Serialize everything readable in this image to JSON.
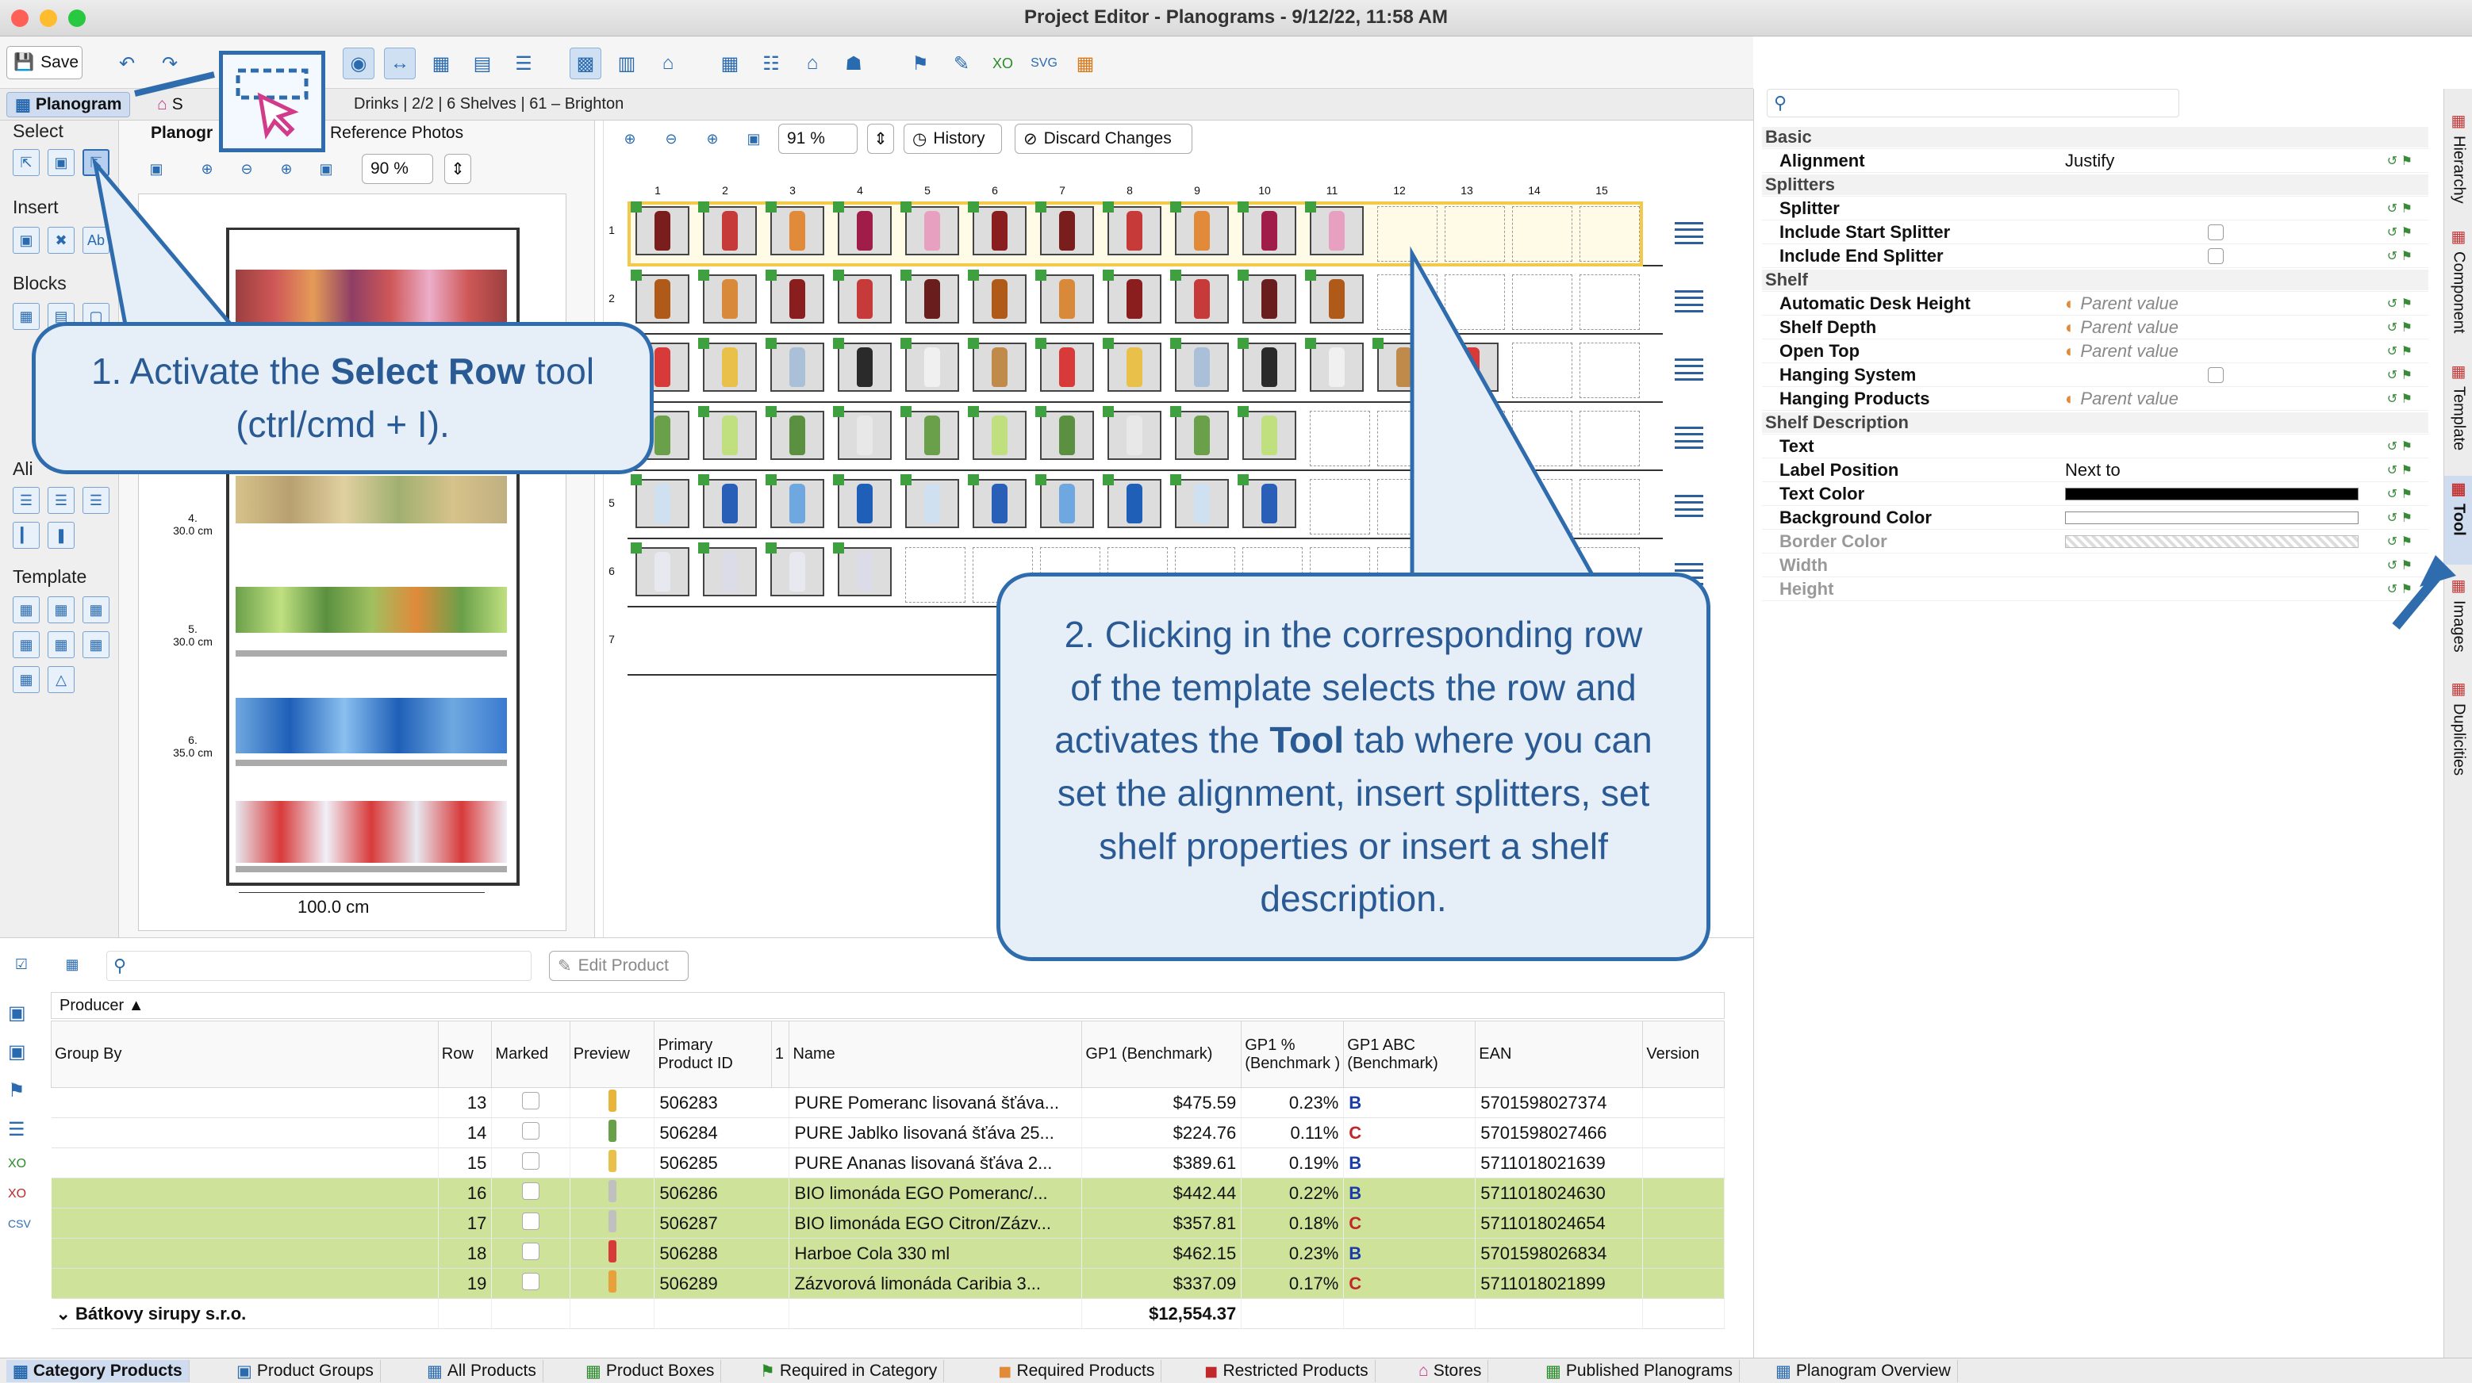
{
  "window": {
    "title": "Project Editor - Planograms - 9/12/22, 11:58 AM"
  },
  "toolbar": {
    "save_label": "Save"
  },
  "tabs": {
    "planogram": "Planogram",
    "s": "S",
    "reference_photos": "Reference Photos",
    "planogram_short": "Planogr",
    "breadcrumb": "Drinks | 2/2 | 6 Shelves | 61 – Brighton"
  },
  "left": {
    "select": "Select",
    "insert": "Insert",
    "blocks": "Blocks",
    "align": "Ali",
    "template": "Template"
  },
  "preview": {
    "zoom": "90 %",
    "width_label": "100.0 cm",
    "shelves": [
      {
        "n": "4.",
        "h": "30.0 cm"
      },
      {
        "n": "5.",
        "h": "30.0 cm"
      },
      {
        "n": "6.",
        "h": "35.0 cm"
      }
    ]
  },
  "canvas": {
    "zoom": "91 %",
    "history": "History",
    "discard": "Discard Changes",
    "cols": [
      "1",
      "2",
      "3",
      "4",
      "5",
      "6",
      "7",
      "8",
      "9",
      "10",
      "11",
      "12",
      "13",
      "14",
      "15"
    ],
    "rows": [
      "1",
      "2",
      "3",
      "4",
      "5",
      "6",
      "7"
    ]
  },
  "props": {
    "search_placeholder": "",
    "rows": [
      {
        "cat": "Basic"
      },
      {
        "k": "Alignment",
        "v": "Justify"
      },
      {
        "cat": "Splitters"
      },
      {
        "k": "Splitter",
        "v": ""
      },
      {
        "k": "Include Start Splitter",
        "v": ""
      },
      {
        "k": "Include End Splitter",
        "v": ""
      },
      {
        "cat": "Shelf"
      },
      {
        "k": "Automatic Desk Height",
        "v": "Parent value"
      },
      {
        "k": "Shelf Depth",
        "v": "Parent value"
      },
      {
        "k": "Open Top",
        "v": "Parent value"
      },
      {
        "k": "Hanging System",
        "v": ""
      },
      {
        "k": "Hanging Products",
        "v": "Parent value"
      },
      {
        "cat": "Shelf Description"
      },
      {
        "k": "Text",
        "v": ""
      },
      {
        "k": "Label Position",
        "v": "Next to"
      },
      {
        "k": "Text Color",
        "v": ""
      },
      {
        "k": "Background Color",
        "v": ""
      },
      {
        "k": "Border Color",
        "v": ""
      },
      {
        "k": "Width",
        "v": ""
      },
      {
        "k": "Height",
        "v": ""
      }
    ]
  },
  "sidetabs": [
    "Hierarchy",
    "Component",
    "Template",
    "Tool",
    "Images",
    "Duplicities"
  ],
  "bottom": {
    "edit_product": "Edit Product",
    "group_header": "Producer",
    "columns": [
      "Group By",
      "Row",
      "Marked",
      "Preview",
      "Primary Product ID",
      "1",
      "Name",
      "GP1 (Benchmark)",
      "GP1 % (Benchmark )",
      "GP1 ABC (Benchmark)",
      "EAN",
      "Version"
    ],
    "rows": [
      {
        "row": "13",
        "id": "506283",
        "name": "PURE Pomeranc lisovaná šťáva...",
        "gp1": "$475.59",
        "pct": "0.23%",
        "abc": "B",
        "ean": "5701598027374",
        "hl": false
      },
      {
        "row": "14",
        "id": "506284",
        "name": "PURE Jablko lisovaná šťáva 25...",
        "gp1": "$224.76",
        "pct": "0.11%",
        "abc": "C",
        "ean": "5701598027466",
        "hl": false
      },
      {
        "row": "15",
        "id": "506285",
        "name": "PURE Ananas lisovaná šťáva 2...",
        "gp1": "$389.61",
        "pct": "0.19%",
        "abc": "B",
        "ean": "5711018021639",
        "hl": false
      },
      {
        "row": "16",
        "id": "506286",
        "name": "BIO limonáda EGO Pomeranc/...",
        "gp1": "$442.44",
        "pct": "0.22%",
        "abc": "B",
        "ean": "5711018024630",
        "hl": true
      },
      {
        "row": "17",
        "id": "506287",
        "name": "BIO limonáda EGO Citron/Zázv...",
        "gp1": "$357.81",
        "pct": "0.18%",
        "abc": "C",
        "ean": "5711018024654",
        "hl": true
      },
      {
        "row": "18",
        "id": "506288",
        "name": "Harboe Cola 330 ml",
        "gp1": "$462.15",
        "pct": "0.23%",
        "abc": "B",
        "ean": "5701598026834",
        "hl": true
      },
      {
        "row": "19",
        "id": "506289",
        "name": "Zázvorová limonáda Caribia 3...",
        "gp1": "$337.09",
        "pct": "0.17%",
        "abc": "C",
        "ean": "5711018021899",
        "hl": true
      }
    ],
    "group_footer": {
      "name": "Bátkovy sirupy s.r.o.",
      "total": "$12,554.37"
    }
  },
  "status_tabs": [
    "Category Products",
    "Product Groups",
    "All Products",
    "Product Boxes",
    "Required in Category",
    "Required Products",
    "Restricted Products",
    "Stores",
    "Published Planograms",
    "Planogram Overview"
  ],
  "callouts": {
    "c1_a": "1. Activate the ",
    "c1_b": "Select Row",
    "c1_c": " tool (ctrl/cmd + I).",
    "c2_a": "2. Clicking in the corresponding row of the template selects the row and activates the ",
    "c2_b": "Tool",
    "c2_c": " tab where you can set the alignment, insert splitters, set shelf properties or insert a shelf description."
  },
  "colors": {
    "accent": "#2f6cae",
    "highlight_row": "#cfe29a",
    "selected_row": "#f3c94a"
  }
}
